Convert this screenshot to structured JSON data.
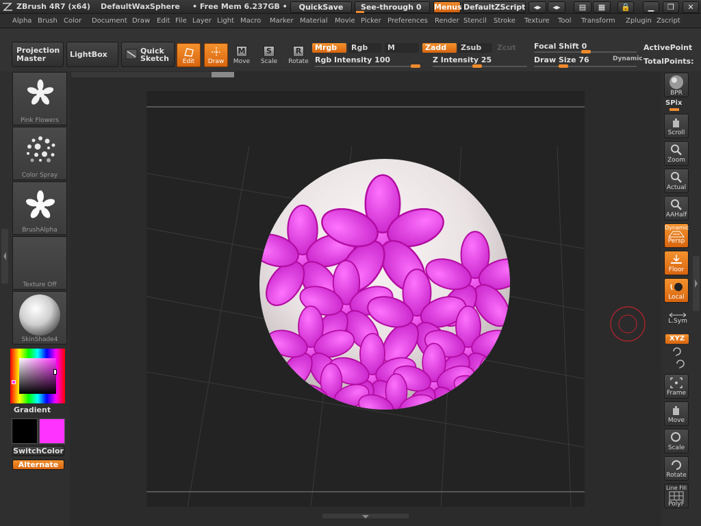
{
  "title": {
    "app": "ZBrush 4R7 (x64)",
    "document": "DefaultWaxSphere",
    "mem": "• Free Mem 6.237GB •",
    "quicksave": "QuickSave",
    "see_through": "See-through   0",
    "menus": "Menus",
    "script": "DefaultZScript"
  },
  "menubar": [
    "Alpha",
    "Brush",
    "Color",
    "Document",
    "Draw",
    "Edit",
    "File",
    "Layer",
    "Light",
    "Macro",
    "Marker",
    "Material",
    "Movie",
    "Picker",
    "Preferences",
    "Render",
    "Stencil",
    "Stroke",
    "Texture",
    "Tool",
    "Transform",
    "Zplugin",
    "Zscript"
  ],
  "shelf": {
    "projection_master": [
      "Projection",
      "Master"
    ],
    "lightbox": "LightBox",
    "quick_sketch": [
      "Quick",
      "Sketch"
    ],
    "edit": "Edit",
    "draw": "Draw",
    "move": "Move",
    "scale": "Scale",
    "rotate": "Rotate",
    "mrgb": "Mrgb",
    "rgb": "Rgb",
    "m": "M",
    "zadd": "Zadd",
    "zsub": "Zsub",
    "zcut": "Zcut",
    "rgb_intensity": "Rgb  Intensity 100",
    "z_intensity": "Z  Intensity 25",
    "focal_shift": "Focal  Shift 0",
    "draw_size": "Draw  Size 76",
    "dynamic": "Dynamic",
    "active_points": "ActivePoint",
    "total_points": "TotalPoints:"
  },
  "left": {
    "brush": "Pink Flowers",
    "stroke": "Color  Spray",
    "alpha": "BrushAlpha",
    "texture": "Texture  Off",
    "material": "SkinShade4",
    "gradient": "Gradient",
    "switch_color": "SwitchColor",
    "alternate": "Alternate",
    "main_color": "#000000",
    "secondary_color": "#ff33ff"
  },
  "right": {
    "bpr": "BPR",
    "spix": "SPix",
    "scroll": "Scroll",
    "zoom": "Zoom",
    "actual": "Actual",
    "aahalf": "AAHalf",
    "dynamic": "Dynamic",
    "persp": "Persp",
    "floor": "Floor",
    "local": "Local",
    "lsym": "L.Sym",
    "xyz": "XYZ",
    "frame": "Frame",
    "move": "Move",
    "scale": "Scale",
    "rotate": "Rotate",
    "line_fill": "Line Fill",
    "polyf": "PolyF"
  },
  "colors": {
    "accent": "#f08a2c",
    "paint": "#ff33ff"
  }
}
